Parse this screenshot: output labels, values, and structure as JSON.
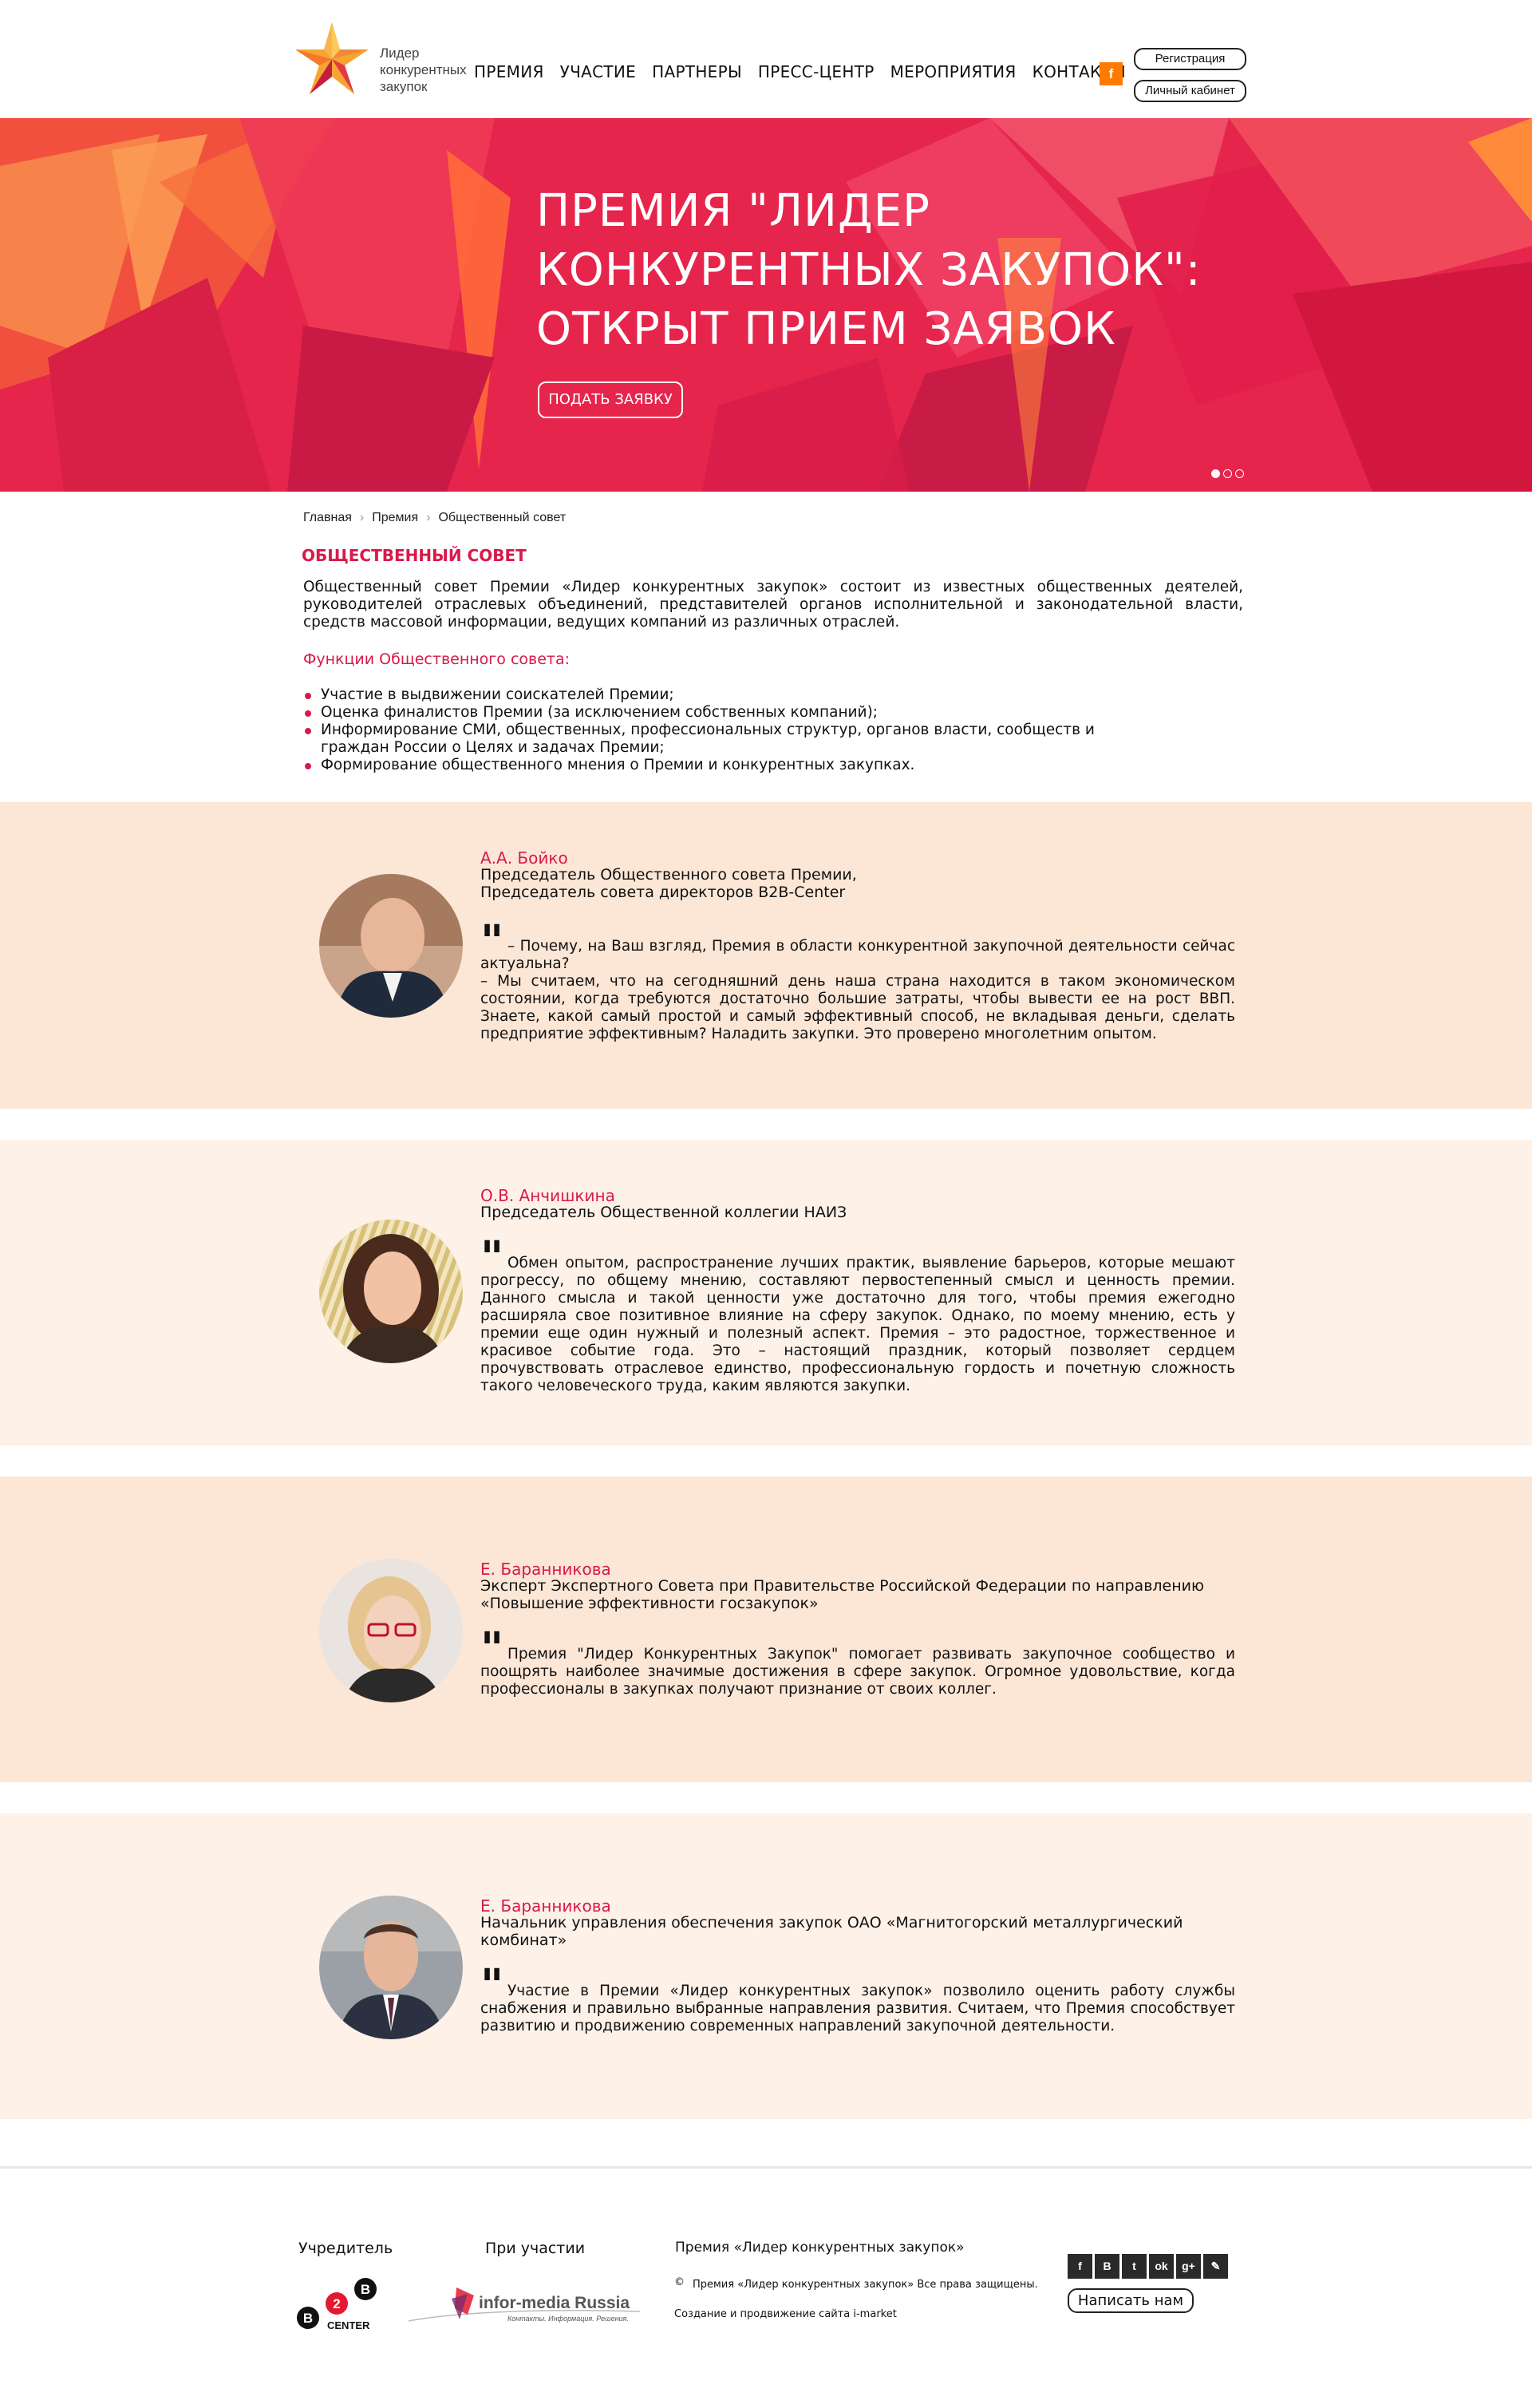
{
  "header": {
    "logo_text": [
      "Лидер",
      "конкурентных",
      "закупок"
    ],
    "nav": [
      "ПРЕМИЯ",
      "УЧАСТИЕ",
      "ПАРТНЕРЫ",
      "ПРЕСС-ЦЕНТР",
      "МЕРОПРИЯТИЯ",
      "КОНТАКТЫ"
    ],
    "facebook_label": "f",
    "register_label": "Регистрация",
    "cabinet_label": "Личный кабинет"
  },
  "hero": {
    "title_lines": [
      "ПРЕМИЯ \"ЛИДЕР",
      "КОНКУРЕНТНЫХ ЗАКУПОК\":",
      "ОТКРЫТ ПРИЕМ ЗАЯВОК"
    ],
    "button_label": "ПОДАТЬ ЗАЯВКУ",
    "slides_total": 3,
    "active_slide": 1
  },
  "breadcrumb": [
    "Главная",
    "Премия",
    "Общественный совет"
  ],
  "page_title": "ОБЩЕСТВЕННЫЙ СОВЕТ",
  "intro": "Общественный совет Премии «Лидер конкурентных закупок» состоит из известных общественных деятелей, руководителей отраслевых объединений, представителей органов исполнительной и законодательной власти, средств массовой информации, ведущих компаний из различных отраслей.",
  "functions_title": "Функции Общественного совета:",
  "functions": [
    "Участие в выдвижении соискателей Премии;",
    "Оценка финалистов Премии (за исключением собственных компаний);",
    "Информирование СМИ, общественных, профессиональных структур, органов власти, сообществ и граждан России о Целях и задачах Премии;",
    "Формирование общественного мнения о Премии и конкурентных закупках."
  ],
  "members": [
    {
      "name": "А.А. Бойко",
      "role": [
        "Председатель Общественного совета Премии,",
        "Председатель совета директоров B2B-Center"
      ],
      "quote": "– Почему, на Ваш взгляд, Премия в области конкурентной закупочной деятельности сейчас актуальна?\n– Мы считаем, что на сегодняшний день наша страна находится в таком экономическом состоянии, когда требуются достаточно большие затраты, чтобы вывести ее на рост ВВП. Знаете, какой самый простой и самый эффективный способ, не вкладывая деньги, сделать предприятие эффективным? Наладить закупки. Это проверено многолетним опытом."
    },
    {
      "name": "О.В. Анчишкина",
      "role": [
        "Председатель Общественной коллегии НАИЗ"
      ],
      "quote": "Обмен опытом, распространение лучших практик, выявление барьеров, которые мешают прогрессу, по общему мнению, составляют первостепенный смысл и ценность премии. Данного смысла и такой ценности уже достаточно для того, чтобы премия ежегодно расширяла свое позитивное влияние на сферу закупок. Однако, по моему мнению, есть у премии еще один нужный и полезный аспект. Премия – это радостное, торжественное и красивое событие года. Это – настоящий праздник, который позволяет сердцем прочувствовать отраслевое единство, профессиональную гордость и почетную сложность такого человеческого труда, каким являются закупки."
    },
    {
      "name": "Е. Баранникова",
      "role": [
        "Эксперт Экспертного Совета при Правительстве Российской Федерации по направлению",
        "«Повышение эффективности госзакупок»"
      ],
      "quote": "Премия \"Лидер Конкурентных Закупок\" помогает развивать закупочное сообщество и поощрять наиболее значимые достижения в сфере закупок. Огромное удовольствие, когда профессионалы в закупках получают признание от своих коллег."
    },
    {
      "name": "Е. Баранникова",
      "role": [
        "Начальник управления обеспечения закупок ОАО «Магнитогорский металлургический",
        "комбинат»"
      ],
      "quote": "Участие в Премии «Лидер конкурентных закупок» позволило оценить работу службы снабжения и правильно выбранные направления развития. Считаем, что Премия способствует развитию и продвижению современных направлений закупочной деятельности."
    }
  ],
  "footer": {
    "founder_label": "Учредитель",
    "founder_logo_text": "CENTER",
    "participation_label": "При участии",
    "partner_logo_text": "infor-media Russia",
    "partner_tagline": "Контакты. Информация. Решения.",
    "award_label": "Премия «Лидер конкурентных закупок»",
    "rights": "Премия «Лидер конкурентных закупок» Все права защищены.",
    "dev": "Создание и продвижение сайта i-market",
    "write_us": "Написать нам",
    "social_icons": [
      "facebook-icon",
      "vk-icon",
      "twitter-icon",
      "odnoklassniki-icon",
      "google-plus-icon",
      "livejournal-icon"
    ],
    "social_glyphs": [
      "f",
      "B",
      "t",
      "ok",
      "g+",
      "✎"
    ]
  },
  "colors": {
    "accent": "#d8194a",
    "hero_red": "#e8204a",
    "orange": "#ff7a00",
    "band_dark": "#fce6d6",
    "band_light": "#fdf1e8"
  }
}
